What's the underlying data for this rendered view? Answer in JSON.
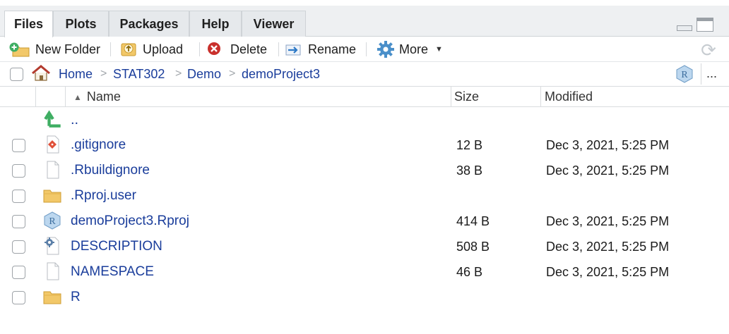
{
  "tabs": [
    {
      "label": "Files",
      "active": true
    },
    {
      "label": "Plots",
      "active": false
    },
    {
      "label": "Packages",
      "active": false
    },
    {
      "label": "Help",
      "active": false
    },
    {
      "label": "Viewer",
      "active": false
    }
  ],
  "toolbar": {
    "new_folder": "New Folder",
    "upload": "Upload",
    "delete": "Delete",
    "rename": "Rename",
    "more": "More"
  },
  "breadcrumb": [
    "Home",
    "STAT302",
    "Demo",
    "demoProject3"
  ],
  "more_menu": "...",
  "columns": {
    "name": "Name",
    "size": "Size",
    "modified": "Modified"
  },
  "parent_dir": "..",
  "files": [
    {
      "name": ".gitignore",
      "icon": "git-file-icon",
      "size": "12 B",
      "modified": "Dec 3, 2021, 5:25 PM"
    },
    {
      "name": ".Rbuildignore",
      "icon": "text-file-icon",
      "size": "38 B",
      "modified": "Dec 3, 2021, 5:25 PM"
    },
    {
      "name": ".Rproj.user",
      "icon": "folder-icon",
      "size": "",
      "modified": ""
    },
    {
      "name": "demoProject3.Rproj",
      "icon": "rproj-file-icon",
      "size": "414 B",
      "modified": "Dec 3, 2021, 5:25 PM"
    },
    {
      "name": "DESCRIPTION",
      "icon": "dcf-file-icon",
      "size": "508 B",
      "modified": "Dec 3, 2021, 5:25 PM"
    },
    {
      "name": "NAMESPACE",
      "icon": "text-file-icon",
      "size": "46 B",
      "modified": "Dec 3, 2021, 5:25 PM"
    },
    {
      "name": "R",
      "icon": "folder-icon",
      "size": "",
      "modified": ""
    }
  ],
  "colors": {
    "link": "#1a3d9b",
    "folder": "#f2c869",
    "up_arrow": "#3fae63"
  }
}
